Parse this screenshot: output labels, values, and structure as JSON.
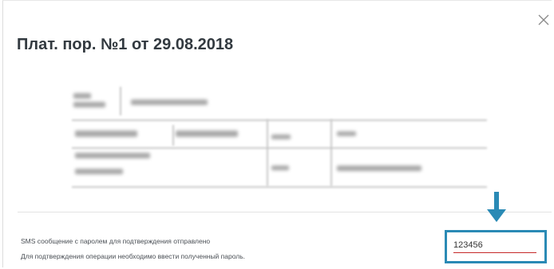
{
  "dialog": {
    "title": "Плат. пор. №1 от 29.08.2018",
    "close_icon": "close-icon"
  },
  "document_preview": {
    "state": "blurred"
  },
  "sms_confirmation": {
    "message_line1": "SMS сообщение с паролем для подтверждения отправлено",
    "message_line2": "Для подтверждения операции необходимо ввести полученный пароль.",
    "code_value": "123456"
  },
  "annotation": {
    "arrow_icon": "arrow-down-icon",
    "highlight_color": "#2a8ab5"
  },
  "colors": {
    "title": "#333a40",
    "input_underline": "#c62828"
  }
}
